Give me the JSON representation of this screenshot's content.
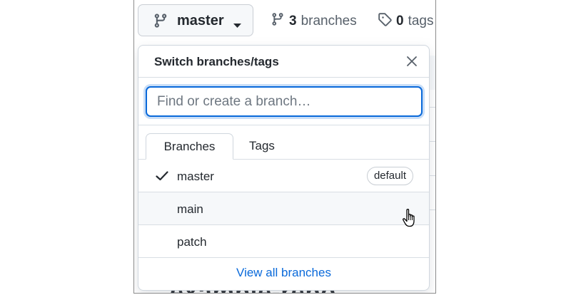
{
  "header": {
    "current_branch": "master",
    "branches_count": "3",
    "branches_label": "branches",
    "tags_count": "0",
    "tags_label": "tags"
  },
  "background": {
    "repo_title": "example-repo"
  },
  "dropdown": {
    "title": "Switch branches/tags",
    "search_placeholder": "Find or create a branch…",
    "search_value": "",
    "tabs": [
      {
        "label": "Branches",
        "active": true
      },
      {
        "label": "Tags",
        "active": false
      }
    ],
    "items": [
      {
        "label": "master",
        "checked": true,
        "badge": "default"
      },
      {
        "label": "main",
        "checked": false,
        "hovered": true
      },
      {
        "label": "patch",
        "checked": false
      }
    ],
    "footer_link": "View all branches"
  },
  "icons": {
    "branch": "git-branch-icon",
    "caret": "caret-down-icon",
    "tag": "tag-icon",
    "close": "close-icon",
    "check": "check-icon",
    "cursor": "hand-pointer-icon"
  },
  "colors": {
    "accent": "#0969da",
    "border": "#d0d7de",
    "hover": "#f6f8fa"
  }
}
